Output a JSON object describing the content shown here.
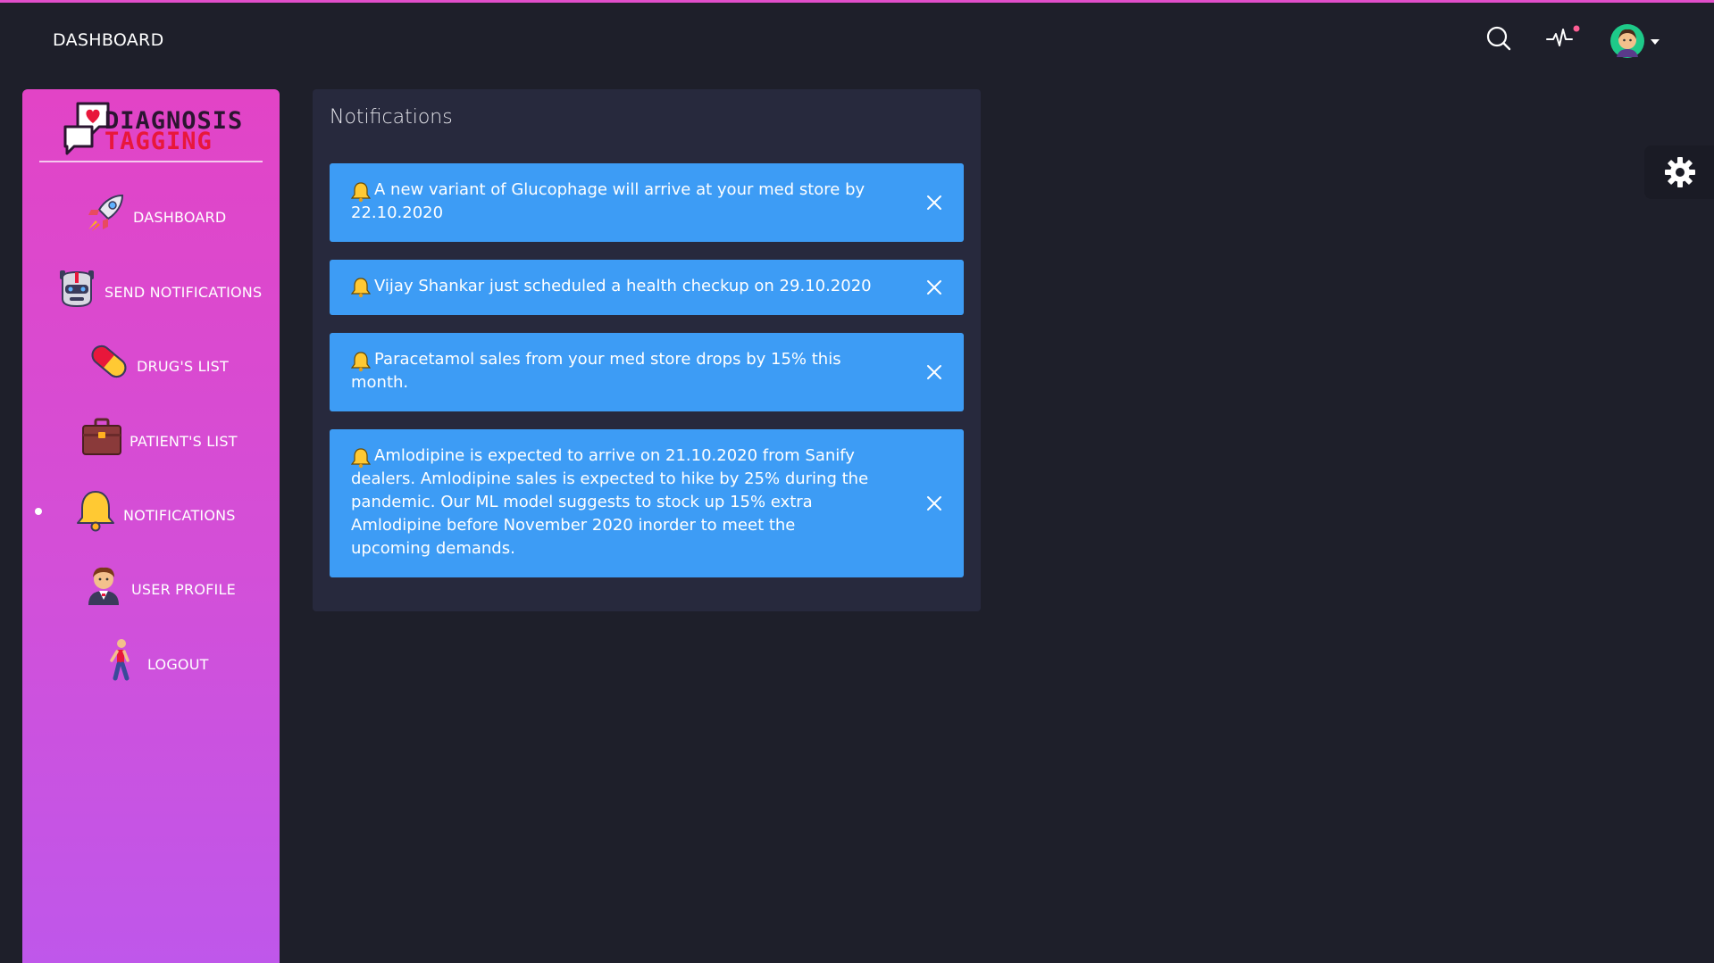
{
  "header": {
    "title": "DASHBOARD",
    "icons": [
      "search-icon",
      "activity-icon",
      "avatar-icon"
    ],
    "accent_color": "#e14eca"
  },
  "sidebar": {
    "logo": {
      "line1": "DIAGNOSIS",
      "line2": "TAGGING"
    },
    "items": [
      {
        "label": "DASHBOARD",
        "icon": "rocket-icon"
      },
      {
        "label": "SEND NOTIFICATIONS",
        "icon": "robot-icon"
      },
      {
        "label": "DRUG'S LIST",
        "icon": "pill-icon"
      },
      {
        "label": "PATIENT'S LIST",
        "icon": "briefcase-icon"
      },
      {
        "label": "NOTIFICATIONS",
        "icon": "bell-icon",
        "active": true
      },
      {
        "label": "USER PROFILE",
        "icon": "user-icon"
      },
      {
        "label": "LOGOUT",
        "icon": "walking-person-icon"
      }
    ],
    "gradient": [
      "#e244c6",
      "#bf57ea"
    ]
  },
  "main": {
    "card_title": "Notifications",
    "notifications": [
      {
        "text": "A new variant of Glucophage will arrive at your med store by 22.10.2020"
      },
      {
        "text": "Vijay Shankar just scheduled a health checkup on 29.10.2020"
      },
      {
        "text": "Paracetamol sales from your med store drops by 15% this month."
      },
      {
        "text": "Amlodipine is expected to arrive on 21.10.2020 from Sanify dealers. Amlodipine sales is expected to hike by 25% during the pandemic. Our ML model suggests to stock up 15% extra Amlodipine before November 2020 inorder to meet the upcoming demands."
      }
    ],
    "alert_color": "#3d9cf5"
  },
  "settings": {
    "icon": "gear-icon"
  }
}
